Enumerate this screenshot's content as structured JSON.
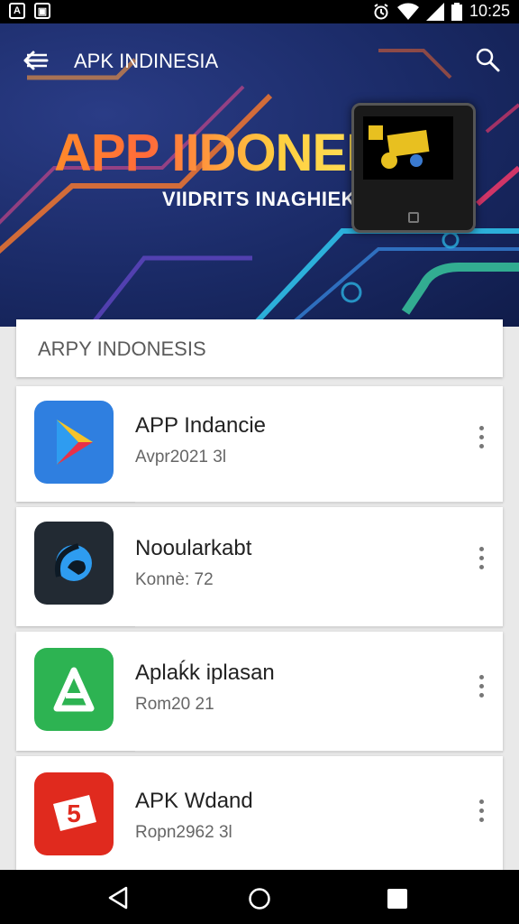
{
  "status_bar": {
    "time": "10:25",
    "left_icons": [
      "app-notification-icon",
      "gallery-notification-icon"
    ],
    "right_icons": [
      "alarm-icon",
      "wifi-icon",
      "signal-icon",
      "battery-icon"
    ]
  },
  "app_bar": {
    "title": "APK INDINESIA",
    "back_icon": "arrow-back-icon",
    "search_icon": "search-icon"
  },
  "banner": {
    "title": "APP IIDONEISA",
    "subtitle": "VIIDRITS INAGHIEK"
  },
  "section": {
    "label": "ARPY INDONESIS"
  },
  "apps": [
    {
      "name": "APP Indancie",
      "meta": "Avpr2021 3l",
      "icon": "play-store-icon",
      "color": "#2f7fe0"
    },
    {
      "name": "Nooularkabt",
      "meta": "Konnè: 72",
      "icon": "orbit-icon",
      "color": "#222a33"
    },
    {
      "name": "Aplaḱk iplasan",
      "meta": "Rom20 21",
      "icon": "letter-a-icon",
      "color": "#2db352"
    },
    {
      "name": "APK Wdand",
      "meta": "Ropn2962 3l",
      "icon": "badge-5-icon",
      "color": "#e02a1e"
    }
  ],
  "nav": {
    "back": "nav-back-icon",
    "home": "nav-home-icon",
    "recents": "nav-recents-icon"
  }
}
